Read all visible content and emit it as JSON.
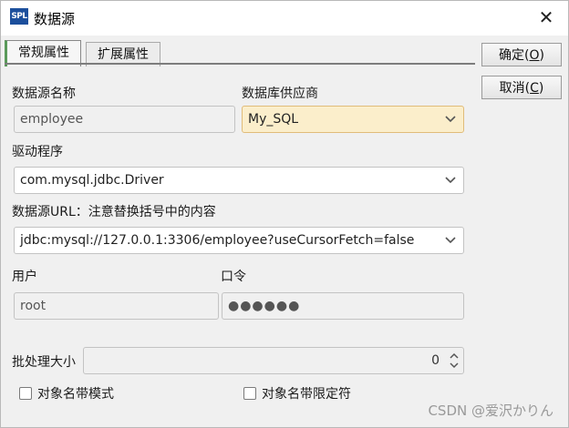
{
  "window": {
    "icon_text": "SPL",
    "title": "数据源",
    "close_glyph": "✕"
  },
  "tabs": [
    {
      "label": "常规属性",
      "active": true
    },
    {
      "label": "扩展属性",
      "active": false
    }
  ],
  "buttons": {
    "ok_label": "确定(",
    "ok_key": "O",
    "ok_tail": ")",
    "cancel_label": "取消(",
    "cancel_key": "C",
    "cancel_tail": ")"
  },
  "form": {
    "ds_name_label": "数据源名称",
    "ds_name_value": "employee",
    "vendor_label": "数据库供应商",
    "vendor_value": "My_SQL",
    "driver_label": "驱动程序",
    "driver_value": "com.mysql.jdbc.Driver",
    "url_label": "数据源URL：注意替换括号中的内容",
    "url_value": "jdbc:mysql://127.0.0.1:3306/employee?useCursorFetch=false",
    "user_label": "用户",
    "user_value": "root",
    "password_label": "口令",
    "password_value": "●●●●●●",
    "batch_label": "批处理大小",
    "batch_value": "0",
    "schema_checkbox_label": "对象名带模式",
    "schema_checked": false,
    "qualifier_checkbox_label": "对象名带限定符",
    "qualifier_checked": false
  },
  "watermark": "CSDN @爱沢かりん",
  "colors": {
    "highlight_bg": "#fbeecb",
    "icon_bg": "#1c4f9c",
    "active_tab_accent": "#5a9a5a"
  }
}
